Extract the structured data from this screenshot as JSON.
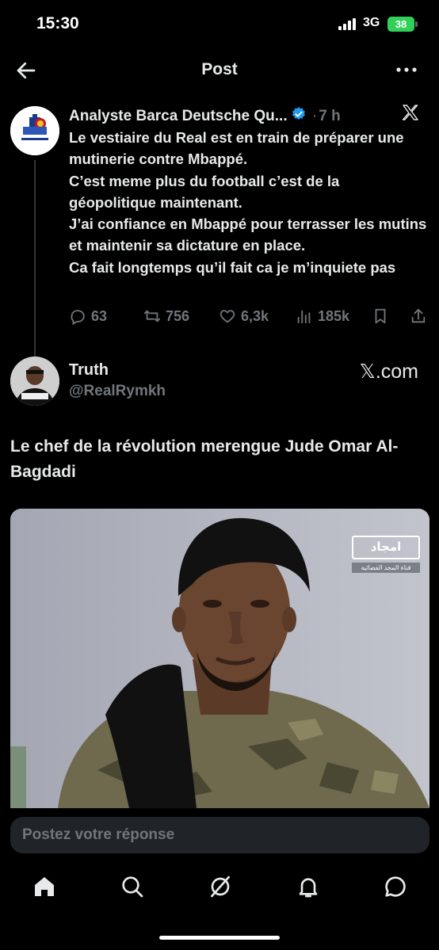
{
  "status_bar": {
    "time": "15:30",
    "network": "3G",
    "battery": "38"
  },
  "header": {
    "title": "Post",
    "back_icon": "arrow-left-icon",
    "more_icon": "more-horizontal-icon"
  },
  "tweet": {
    "author_name": "Analyste Barca Deutsche Qu...",
    "verified": true,
    "separator": "·",
    "time": "7 h",
    "lines": [
      "Le vestiaire du Real est en train de préparer une mutinerie contre Mbappé.",
      "C’est meme plus du football c’est de la géopolitique maintenant.",
      "J’ai confiance en Mbappé pour terrasser les mutins et maintenir sa dictature en place.",
      "Ca fait longtemps qu’il fait ca je m’inquiete pas"
    ],
    "actions": {
      "replies": "63",
      "reposts": "756",
      "likes": "6,3k",
      "views": "185k"
    }
  },
  "quoted": {
    "name": "Truth",
    "handle": "@RealRymkh",
    "source": "𝕏.com",
    "text": "Le chef de la révolution merengue Jude Omar Al-Bagdadi",
    "media_logo": "امجاد",
    "media_logo_sub": "قناة المجد الفضائية"
  },
  "reply": {
    "placeholder": "Postez votre réponse"
  },
  "nav": {
    "items": [
      "home-icon",
      "search-icon",
      "grok-icon",
      "notifications-icon",
      "messages-icon"
    ]
  },
  "colors": {
    "background": "#000000",
    "text": "#e7e9ea",
    "muted": "#71767b",
    "verified": "#1d9bf0",
    "battery": "#30d158"
  }
}
